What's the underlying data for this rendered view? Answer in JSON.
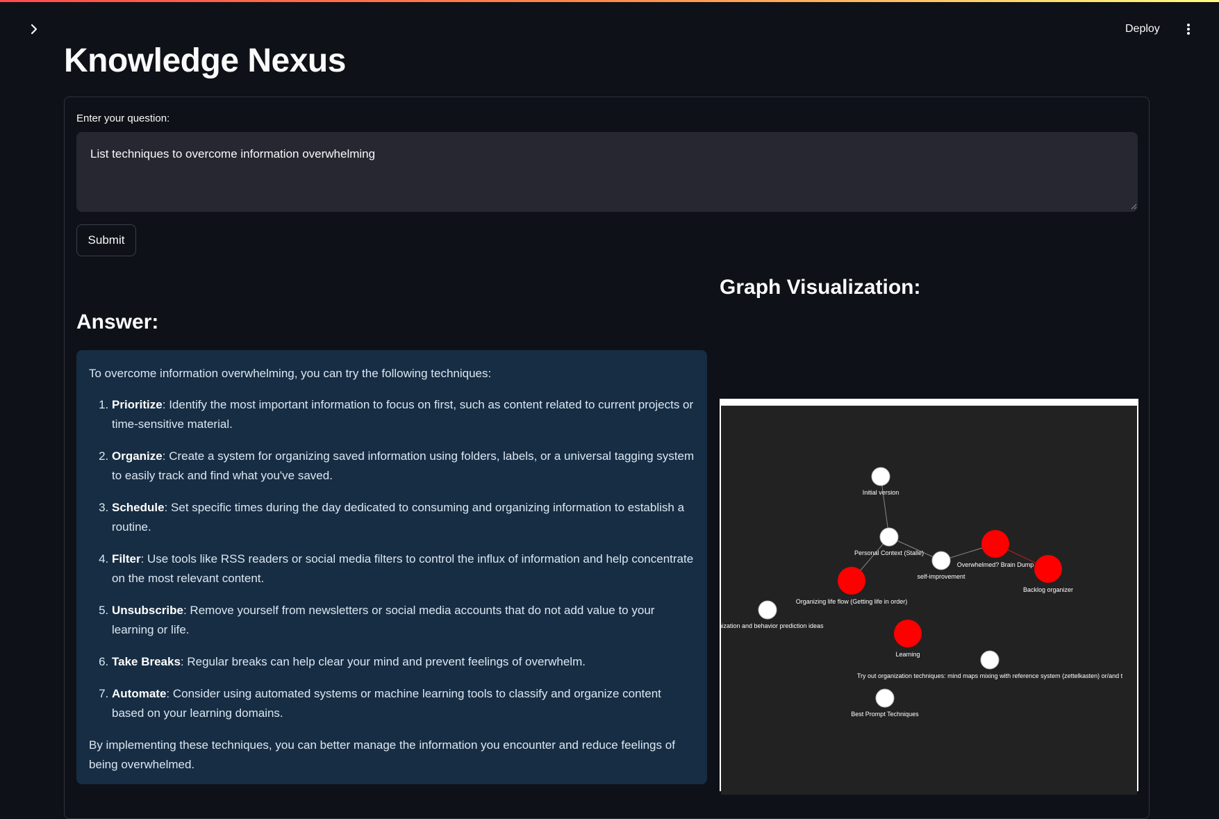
{
  "app": {
    "deploy_label": "Deploy",
    "title": "Knowledge Nexus"
  },
  "form": {
    "question_label": "Enter your question:",
    "question_value": "List techniques to overcome information overwhelming",
    "submit_label": "Submit"
  },
  "answer": {
    "heading": "Answer:",
    "intro": "To overcome information overwhelming, you can try the following techniques:",
    "items": [
      {
        "title": "Prioritize",
        "text": ": Identify the most important information to focus on first, such as content related to current projects or time-sensitive material."
      },
      {
        "title": "Organize",
        "text": ": Create a system for organizing saved information using folders, labels, or a universal tagging system to easily track and find what you've saved."
      },
      {
        "title": "Schedule",
        "text": ": Set specific times during the day dedicated to consuming and organizing information to establish a routine."
      },
      {
        "title": "Filter",
        "text": ": Use tools like RSS readers or social media filters to control the influx of information and help concentrate on the most relevant content."
      },
      {
        "title": "Unsubscribe",
        "text": ": Remove yourself from newsletters or social media accounts that do not add value to your learning or life."
      },
      {
        "title": "Take Breaks",
        "text": ": Regular breaks can help clear your mind and prevent feelings of overwhelm."
      },
      {
        "title": "Automate",
        "text": ": Consider using automated systems or machine learning tools to classify and organize content based on your learning domains."
      }
    ],
    "outro": "By implementing these techniques, you can better manage the information you encounter and reduce feelings of being overwhelmed."
  },
  "graph": {
    "heading": "Graph Visualization:",
    "colors": {
      "background": "#222222",
      "highlight_node": "#ff0000",
      "regular_node": "#ffffff",
      "regular_edge": "#888888",
      "highlight_edge": "#b22222"
    },
    "nodes": [
      {
        "label": "Initial version",
        "highlighted": false
      },
      {
        "label": "Personal Context (Stalle)",
        "highlighted": false
      },
      {
        "label": "self-improvement",
        "highlighted": false
      },
      {
        "label": "Overwhelmed? Brain Dump",
        "highlighted": true
      },
      {
        "label": "Backlog organizer",
        "highlighted": true
      },
      {
        "label": "Organizing life flow (Getting life in order)",
        "highlighted": true
      },
      {
        "label": "ganization and behavior prediction ideas",
        "highlighted": false
      },
      {
        "label": "Learning",
        "highlighted": true
      },
      {
        "label": "Try out organization techniques: mind maps mixing with reference system (zettelkasten) or/and t",
        "highlighted": false
      },
      {
        "label": "Best Prompt Techniques",
        "highlighted": false
      }
    ],
    "edges": [
      {
        "from": "Initial version",
        "to": "Personal Context (Stalle)"
      },
      {
        "from": "Personal Context (Stalle)",
        "to": "self-improvement"
      },
      {
        "from": "Personal Context (Stalle)",
        "to": "Organizing life flow (Getting life in order)"
      },
      {
        "from": "self-improvement",
        "to": "Overwhelmed? Brain Dump"
      },
      {
        "from": "Overwhelmed? Brain Dump",
        "to": "Backlog organizer"
      }
    ]
  }
}
